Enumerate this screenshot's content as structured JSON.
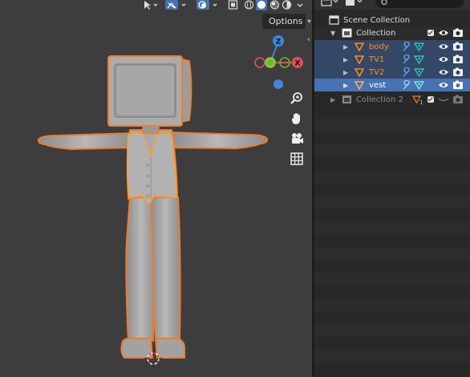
{
  "viewport": {
    "options_label": "Options",
    "gizmo": {
      "z_label": "Z",
      "x_label": "X"
    },
    "colors": {
      "x_axis": "#e44b5d",
      "y_axis": "#6eb32d",
      "z_axis": "#3f86e0",
      "selection_outline": "#f07d28",
      "model": "#a8a8a8"
    }
  },
  "outliner": {
    "items": [
      {
        "label": "Scene Collection",
        "type": "scene-collection"
      },
      {
        "label": "Collection",
        "type": "collection"
      },
      {
        "label": "body",
        "type": "mesh-object",
        "selected": true
      },
      {
        "label": "TV1",
        "type": "mesh-object",
        "selected": true
      },
      {
        "label": "TV2",
        "type": "mesh-object",
        "selected": true
      },
      {
        "label": "vest",
        "type": "mesh-object",
        "selected": true,
        "active": true
      },
      {
        "label": "Collection 2",
        "type": "collection",
        "excluded": true
      }
    ],
    "collection2_badge": "1",
    "colors": {
      "selected_row": "#334766",
      "active_row": "#4772b3",
      "object_name": "#ff8c1a",
      "mesh_icon": "#ff8c1a",
      "modifier_icon": "#5fa8e8",
      "data_icon": "#2ec4b6"
    }
  }
}
